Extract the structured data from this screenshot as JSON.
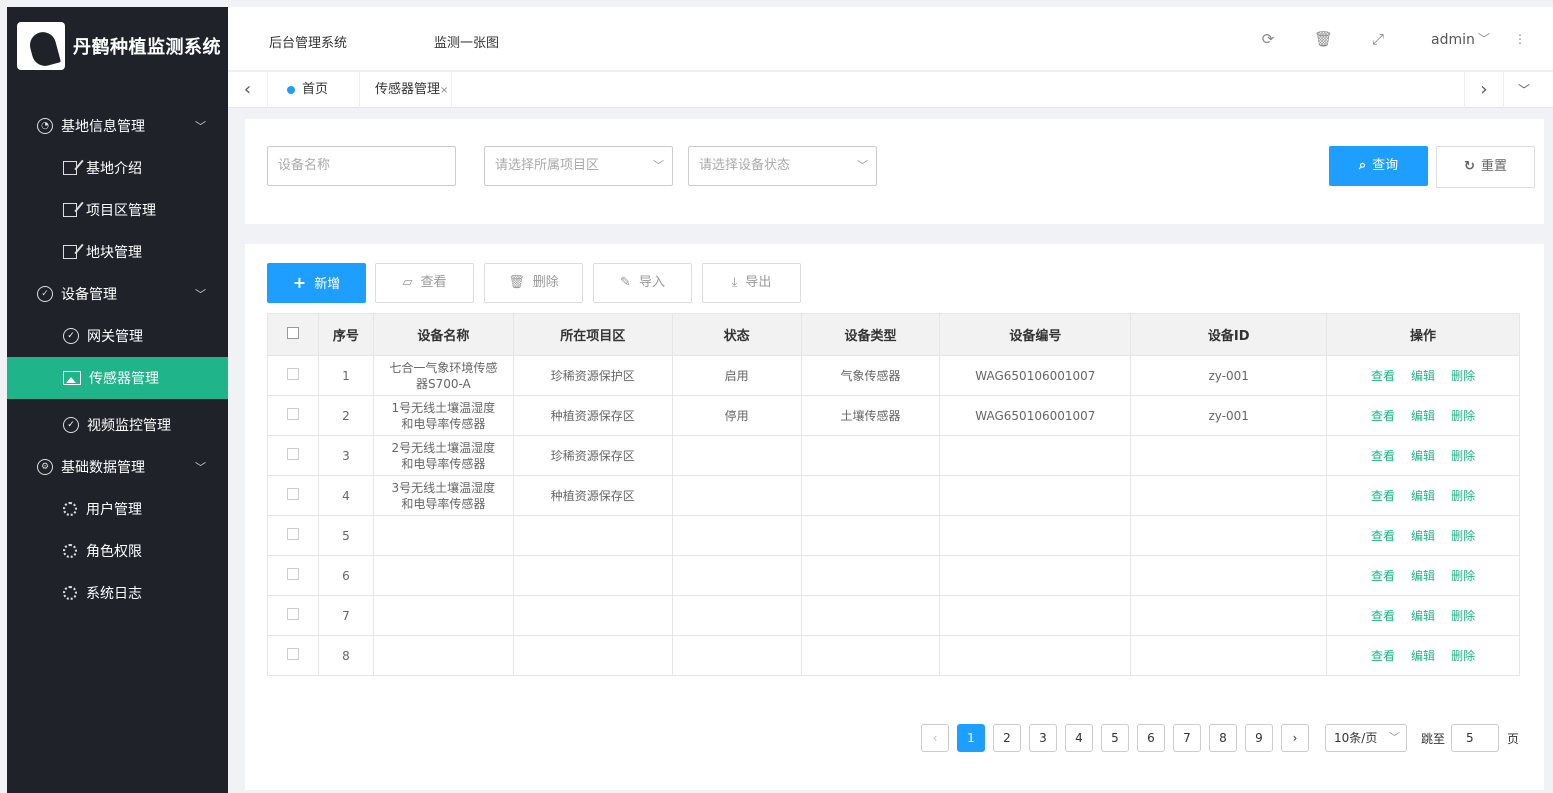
{
  "app": {
    "title": "丹鹤种植监测系统"
  },
  "sidebar": {
    "groups": [
      {
        "label": "基地信息管理",
        "items": [
          "基地介绍",
          "项目区管理",
          "地块管理"
        ]
      },
      {
        "label": "设备管理",
        "items": [
          "网关管理",
          "传感器管理",
          "视频监控管理"
        ]
      },
      {
        "label": "基础数据管理",
        "items": [
          "用户管理",
          "角色权限",
          "系统日志"
        ]
      }
    ]
  },
  "header": {
    "link1": "后台管理系统",
    "link2": "监测一张图",
    "user": "admin",
    "icons": [
      "refresh-icon",
      "trash-icon",
      "fullscreen-icon",
      "chevron-down-icon",
      "more-icon"
    ]
  },
  "tabs": {
    "home": "首页",
    "current": "传感器管理",
    "close": "×"
  },
  "search": {
    "name_placeholder": "设备名称",
    "area_placeholder": "请选择所属项目区",
    "status_placeholder": "请选择设备状态",
    "query_label": "查询",
    "reset_label": "重置"
  },
  "toolbar": {
    "add": "新增",
    "view": "查看",
    "delete": "删除",
    "import": "导入",
    "export": "导出"
  },
  "table": {
    "headers": [
      "序号",
      "设备名称",
      "所在项目区",
      "状态",
      "设备类型",
      "设备编号",
      "设备ID",
      "操作"
    ],
    "actions": {
      "view": "查看",
      "edit": "编辑",
      "delete": "删除"
    },
    "rows": [
      {
        "no": "1",
        "name": "七合一气象环境传感器S700-A",
        "area": "珍稀资源保护区",
        "status": "启用",
        "type": "气象传感器",
        "code": "WAG650106001007",
        "id": "zy-001"
      },
      {
        "no": "2",
        "name": "1号无线土壤温湿度和电导率传感器",
        "area": "种植资源保存区",
        "status": "停用",
        "type": "土壤传感器",
        "code": "WAG650106001007",
        "id": "zy-001"
      },
      {
        "no": "3",
        "name": "2号无线土壤温湿度和电导率传感器",
        "area": "珍稀资源保存区",
        "status": "",
        "type": "",
        "code": "",
        "id": ""
      },
      {
        "no": "4",
        "name": "3号无线土壤温湿度和电导率传感器",
        "area": "种植资源保存区",
        "status": "",
        "type": "",
        "code": "",
        "id": ""
      },
      {
        "no": "5",
        "name": "",
        "area": "",
        "status": "",
        "type": "",
        "code": "",
        "id": ""
      },
      {
        "no": "6",
        "name": "",
        "area": "",
        "status": "",
        "type": "",
        "code": "",
        "id": ""
      },
      {
        "no": "7",
        "name": "",
        "area": "",
        "status": "",
        "type": "",
        "code": "",
        "id": ""
      },
      {
        "no": "8",
        "name": "",
        "area": "",
        "status": "",
        "type": "",
        "code": "",
        "id": ""
      }
    ]
  },
  "pagination": {
    "prev": "‹",
    "next": "›",
    "pages": [
      "1",
      "2",
      "3",
      "4",
      "5",
      "6",
      "7",
      "8",
      "9"
    ],
    "current": "1",
    "page_size": "10条/页",
    "jump_label": "跳至",
    "jump_value": "5",
    "jump_unit": "页"
  },
  "colors": {
    "primary": "#1e9fff",
    "accent": "#20b48a",
    "sidebar": "#1f2329"
  }
}
